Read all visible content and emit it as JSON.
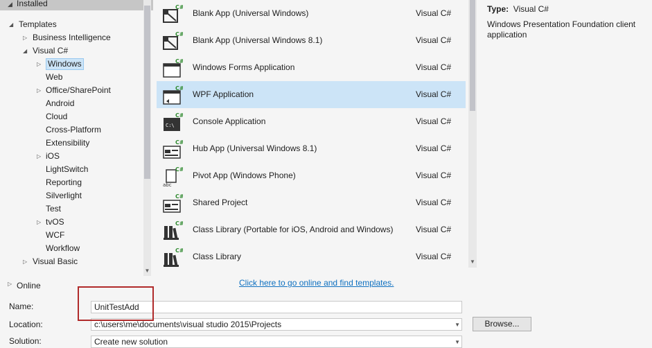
{
  "tree": {
    "installed": "Installed",
    "items": [
      {
        "label": "Templates",
        "tri": "◢"
      },
      {
        "label": "Business Intelligence",
        "tri": "▷"
      },
      {
        "label": "Visual C#",
        "tri": "◢"
      },
      {
        "label": "Windows",
        "tri": "▷"
      },
      {
        "label": "Web",
        "tri": ""
      },
      {
        "label": "Office/SharePoint",
        "tri": "▷"
      },
      {
        "label": "Android",
        "tri": ""
      },
      {
        "label": "Cloud",
        "tri": ""
      },
      {
        "label": "Cross-Platform",
        "tri": ""
      },
      {
        "label": "Extensibility",
        "tri": ""
      },
      {
        "label": "iOS",
        "tri": "▷"
      },
      {
        "label": "LightSwitch",
        "tri": ""
      },
      {
        "label": "Reporting",
        "tri": ""
      },
      {
        "label": "Silverlight",
        "tri": ""
      },
      {
        "label": "Test",
        "tri": ""
      },
      {
        "label": "tvOS",
        "tri": "▷"
      },
      {
        "label": "WCF",
        "tri": ""
      },
      {
        "label": "Workflow",
        "tri": ""
      },
      {
        "label": "Visual Basic",
        "tri": "▷"
      }
    ],
    "online": "Online"
  },
  "templates": [
    {
      "name": "Blank App (Universal Windows)",
      "lang": "Visual C#",
      "icon": "universal-app-icon"
    },
    {
      "name": "Blank App (Universal Windows 8.1)",
      "lang": "Visual C#",
      "icon": "universal-app-icon"
    },
    {
      "name": "Windows Forms Application",
      "lang": "Visual C#",
      "icon": "windows-forms-icon"
    },
    {
      "name": "WPF Application",
      "lang": "Visual C#",
      "icon": "wpf-icon"
    },
    {
      "name": "Console Application",
      "lang": "Visual C#",
      "icon": "console-icon"
    },
    {
      "name": "Hub App (Universal Windows 8.1)",
      "lang": "Visual C#",
      "icon": "hub-app-icon"
    },
    {
      "name": "Pivot App (Windows Phone)",
      "lang": "Visual C#",
      "icon": "pivot-app-icon"
    },
    {
      "name": "Shared Project",
      "lang": "Visual C#",
      "icon": "shared-project-icon"
    },
    {
      "name": "Class Library (Portable for iOS, Android and Windows)",
      "lang": "Visual C#",
      "icon": "class-library-icon"
    },
    {
      "name": "Class Library",
      "lang": "Visual C#",
      "icon": "class-library-icon"
    }
  ],
  "details": {
    "type_label": "Type:",
    "type_value": "Visual C#",
    "description": "Windows Presentation Foundation client application"
  },
  "online_link": "Click here to go online and find templates.",
  "form": {
    "name_label": "Name:",
    "name_value": "UnitTestAdd",
    "location_label": "Location:",
    "location_value": "c:\\users\\me\\documents\\visual studio 2015\\Projects",
    "solution_label": "Solution:",
    "solution_value": "Create new solution",
    "browse": "Browse..."
  },
  "colors": {
    "selection": "#cce4f7",
    "link": "#0e70c0",
    "highlight": "#b02a2a",
    "csharp_green": "#2f8a2f"
  }
}
